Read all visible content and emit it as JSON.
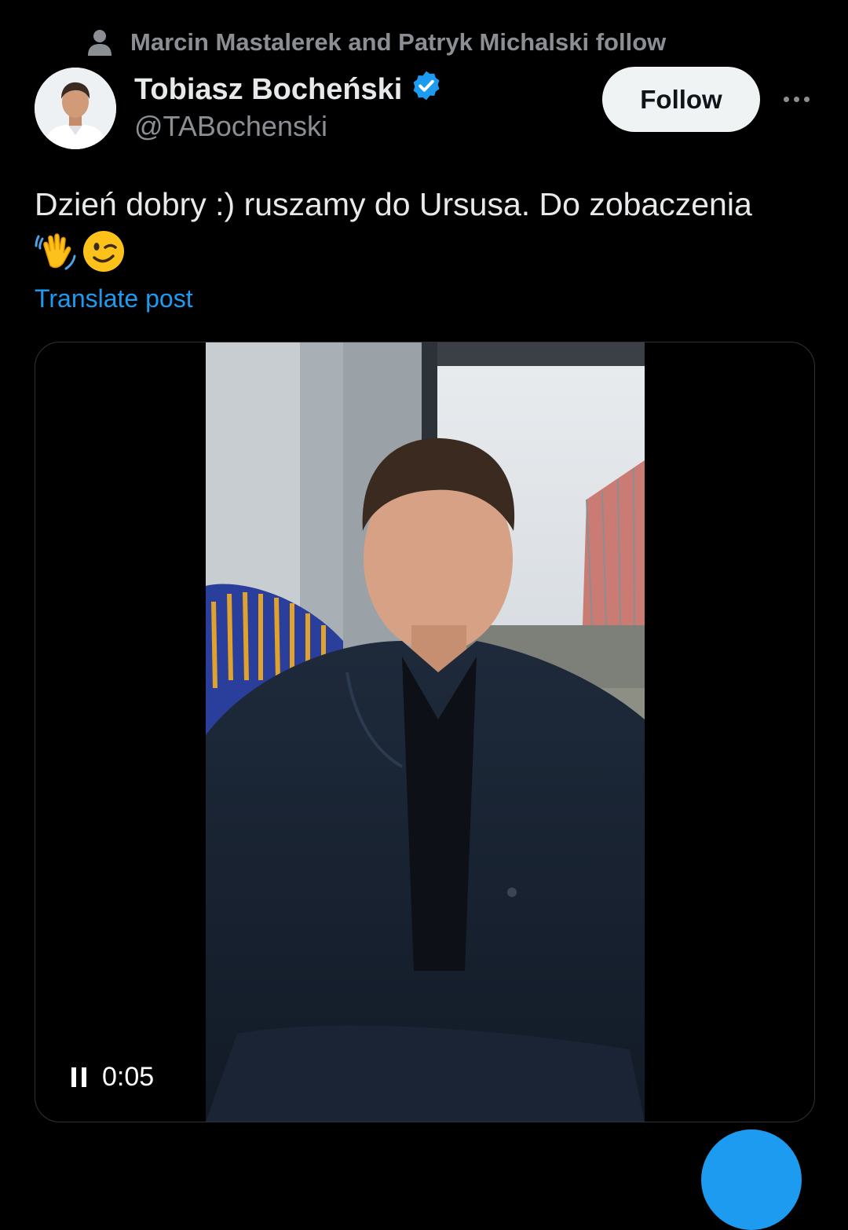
{
  "social_context": {
    "text": "Marcin Mastalerek and Patryk Michalski follow"
  },
  "author": {
    "name": "Tobiasz Bocheński",
    "handle": "@TABochenski",
    "verified": true
  },
  "follow_button": {
    "label": "Follow"
  },
  "post": {
    "text": "Dzień dobry :) ruszamy do Ursusa. Do zobaczenia",
    "emojis": [
      "waving-hand-icon",
      "winking-face-icon"
    ],
    "translate_label": "Translate post"
  },
  "video": {
    "state": "playing",
    "time": "0:05"
  },
  "colors": {
    "accent": "#1d9bf0",
    "background": "#000000",
    "muted": "#8b8f94",
    "text": "#e7e9ea"
  }
}
